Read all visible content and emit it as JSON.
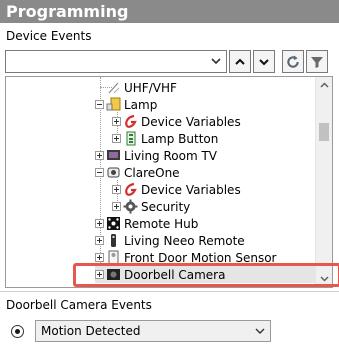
{
  "panel": {
    "title": "Programming"
  },
  "device_events": {
    "label": "Device Events",
    "search_value": "",
    "tree": [
      {
        "label": "UHF/VHF",
        "icon": "antenna-icon",
        "expander": "none"
      },
      {
        "label": "Lamp",
        "icon": "lamp-icon",
        "expander": "minus"
      },
      {
        "label": "Device Variables",
        "icon": "variables-icon",
        "expander": "plus"
      },
      {
        "label": "Lamp Button",
        "icon": "button-icon",
        "expander": "plus"
      },
      {
        "label": "Living Room TV",
        "icon": "tv-icon",
        "expander": "plus"
      },
      {
        "label": "ClareOne",
        "icon": "camera-device-icon",
        "expander": "minus"
      },
      {
        "label": "Device Variables",
        "icon": "variables-icon",
        "expander": "plus"
      },
      {
        "label": "Security",
        "icon": "gear-icon",
        "expander": "plus"
      },
      {
        "label": "Remote Hub",
        "icon": "hub-icon",
        "expander": "plus"
      },
      {
        "label": "Living Neeo Remote",
        "icon": "remote-icon",
        "expander": "plus"
      },
      {
        "label": "Front Door Motion Sensor",
        "icon": "sensor-icon",
        "expander": "plus"
      },
      {
        "label": "Doorbell Camera",
        "icon": "doorbell-camera-icon",
        "expander": "plus",
        "highlighted": true
      }
    ]
  },
  "doorbell_events": {
    "label": "Doorbell Camera Events",
    "selected_event": "Motion Detected"
  },
  "colors": {
    "title_bar": "#8a8a8a",
    "highlight": "#e8574b",
    "variables_red": "#d32f2f"
  }
}
